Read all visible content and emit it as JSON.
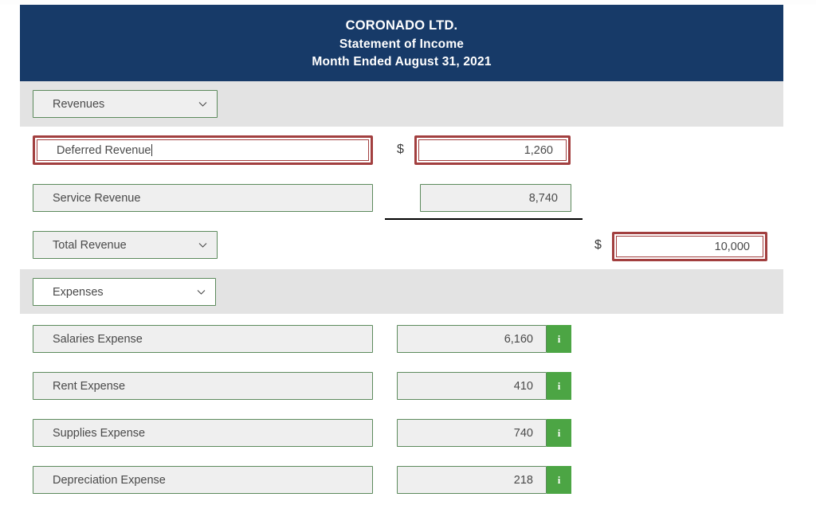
{
  "header": {
    "company": "CORONADO LTD.",
    "statement": "Statement of Income",
    "period": "Month Ended August 31, 2021",
    "bg_color": "#173a68",
    "text_color": "#ffffff"
  },
  "colors": {
    "navy": "#173a68",
    "band_gray": "#e3e3e3",
    "field_green_border": "#5c8a5c",
    "field_fill": "#efefef",
    "error_red": "#a23f3f",
    "info_green": "#4ca544"
  },
  "sections": {
    "revenues": {
      "selector_label": "Revenues",
      "selector_icon": "chevron-down-icon"
    },
    "expenses": {
      "selector_label": "Expenses",
      "selector_icon": "chevron-down-icon"
    }
  },
  "revenue_rows": [
    {
      "account": "Deferred Revenue",
      "amount": "1,260",
      "currency_symbol": "$",
      "state": "error",
      "focused": true,
      "has_info": false
    },
    {
      "account": "Service Revenue",
      "amount": "8,740",
      "currency_symbol": "",
      "state": "normal",
      "focused": false,
      "has_info": false
    }
  ],
  "total_revenue": {
    "label": "Total Revenue",
    "selector_icon": "chevron-down-icon",
    "currency_symbol": "$",
    "amount": "10,000",
    "state": "error"
  },
  "expense_rows": [
    {
      "account": "Salaries Expense",
      "amount": "6,160",
      "has_info": true,
      "info_icon": "info-icon"
    },
    {
      "account": "Rent Expense",
      "amount": "410",
      "has_info": true,
      "info_icon": "info-icon"
    },
    {
      "account": "Supplies Expense",
      "amount": "740",
      "has_info": true,
      "info_icon": "info-icon"
    },
    {
      "account": "Depreciation Expense",
      "amount": "218",
      "has_info": true,
      "info_icon": "info-icon"
    }
  ]
}
